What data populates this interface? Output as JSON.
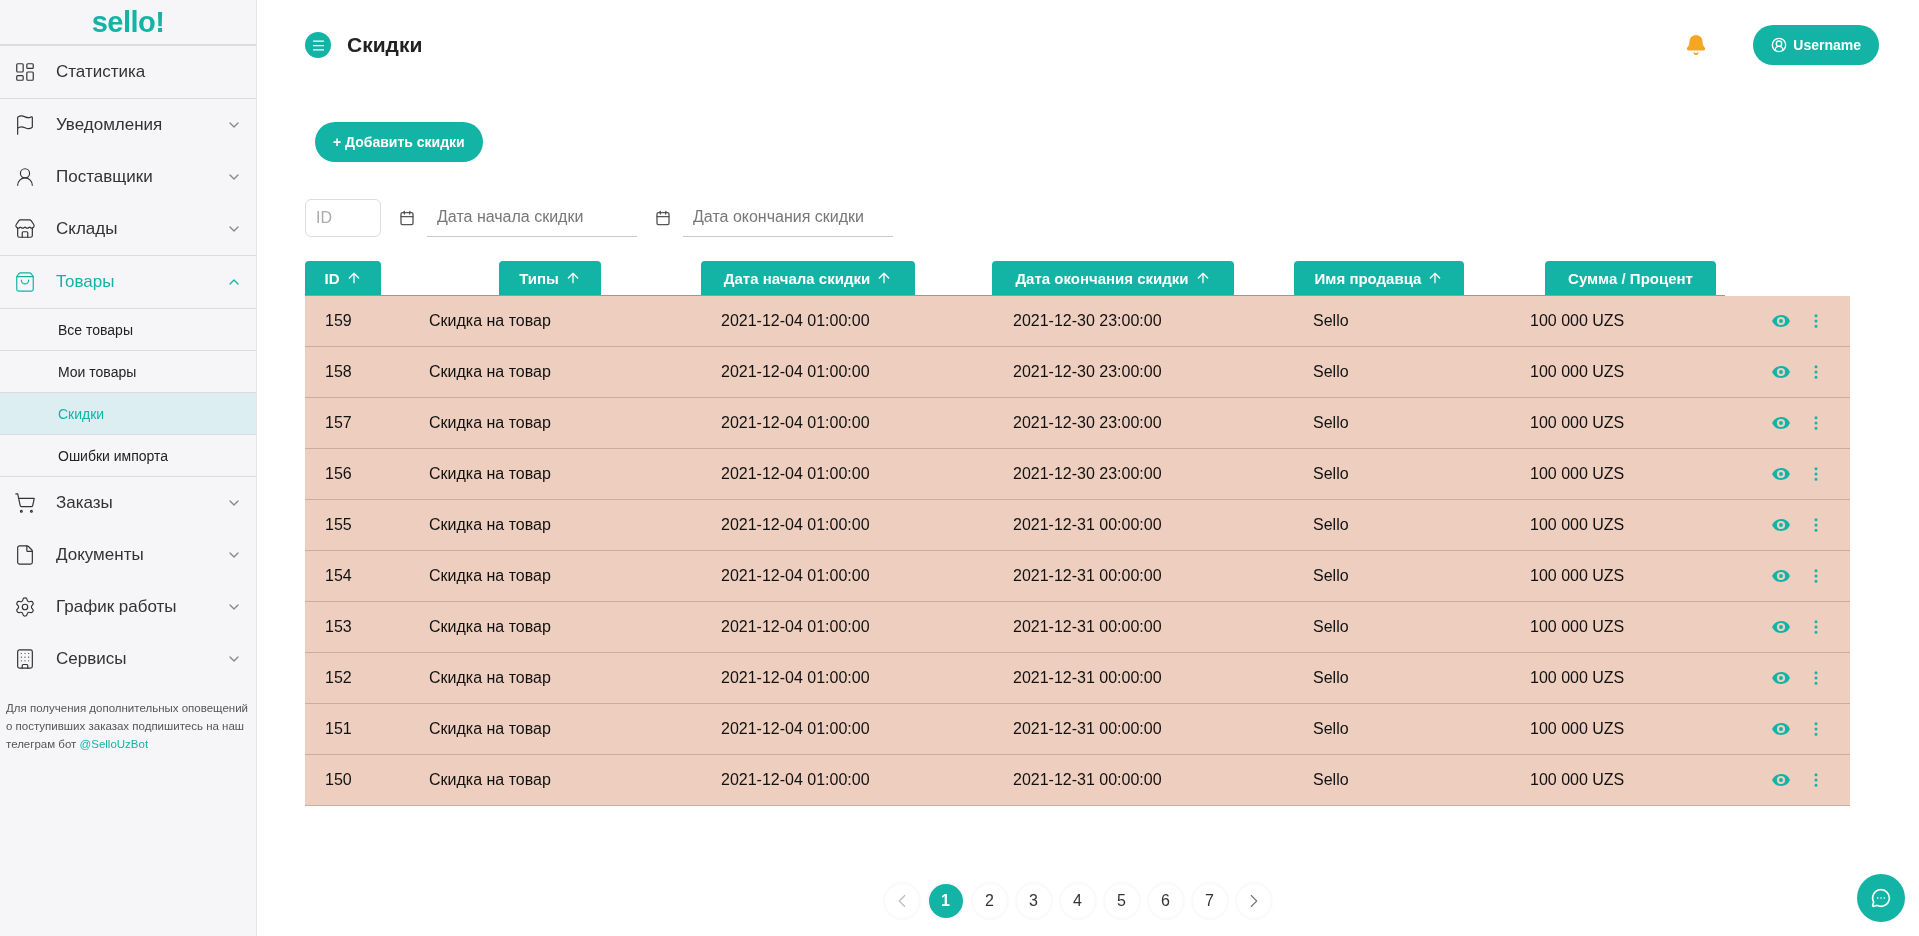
{
  "sidebar": {
    "logo": "sello!",
    "items": [
      {
        "label": "Статистика",
        "expandable": false,
        "expanded": false
      },
      {
        "label": "Уведомления",
        "expandable": true,
        "expanded": false
      },
      {
        "label": "Поставщики",
        "expandable": true,
        "expanded": false
      },
      {
        "label": "Склады",
        "expandable": true,
        "expanded": false
      },
      {
        "label": "Товары",
        "expandable": true,
        "expanded": true,
        "children": [
          {
            "label": "Все товары",
            "selected": false
          },
          {
            "label": "Мои товары",
            "selected": false
          },
          {
            "label": "Скидки",
            "selected": true
          },
          {
            "label": "Ошибки импорта",
            "selected": false
          }
        ]
      },
      {
        "label": "Заказы",
        "expandable": true,
        "expanded": false
      },
      {
        "label": "Документы",
        "expandable": true,
        "expanded": false
      },
      {
        "label": "График работы",
        "expandable": true,
        "expanded": false
      },
      {
        "label": "Сервисы",
        "expandable": true,
        "expanded": false
      }
    ],
    "note": "Для получения дополнительных оповещений о поступивших заказах подпишитесь на наш телеграм бот ",
    "note_link": "@SelloUzBot"
  },
  "header": {
    "title": "Скидки",
    "user": "Username"
  },
  "add_button": "+ Добавить скидки",
  "filters": {
    "id_placeholder": "ID",
    "start_placeholder": "Дата начала скидки",
    "end_placeholder": "Дата окончания скидки"
  },
  "table": {
    "columns": [
      {
        "label": "ID",
        "sortable": true
      },
      {
        "label": "Типы",
        "sortable": true
      },
      {
        "label": "Дата начала скидки",
        "sortable": true
      },
      {
        "label": "Дата окончания скидки",
        "sortable": true
      },
      {
        "label": "Имя продавца",
        "sortable": true
      },
      {
        "label": "Сумма / Процент",
        "sortable": false
      }
    ],
    "rows": [
      [
        "159",
        "Скидка на товар",
        "2021-12-04 01:00:00",
        "2021-12-30 23:00:00",
        "Sello",
        "100 000 UZS"
      ],
      [
        "158",
        "Скидка на товар",
        "2021-12-04 01:00:00",
        "2021-12-30 23:00:00",
        "Sello",
        "100 000 UZS"
      ],
      [
        "157",
        "Скидка на товар",
        "2021-12-04 01:00:00",
        "2021-12-30 23:00:00",
        "Sello",
        "100 000 UZS"
      ],
      [
        "156",
        "Скидка на товар",
        "2021-12-04 01:00:00",
        "2021-12-30 23:00:00",
        "Sello",
        "100 000 UZS"
      ],
      [
        "155",
        "Скидка на товар",
        "2021-12-04 01:00:00",
        "2021-12-31 00:00:00",
        "Sello",
        "100 000 UZS"
      ],
      [
        "154",
        "Скидка на товар",
        "2021-12-04 01:00:00",
        "2021-12-31 00:00:00",
        "Sello",
        "100 000 UZS"
      ],
      [
        "153",
        "Скидка на товар",
        "2021-12-04 01:00:00",
        "2021-12-31 00:00:00",
        "Sello",
        "100 000 UZS"
      ],
      [
        "152",
        "Скидка на товар",
        "2021-12-04 01:00:00",
        "2021-12-31 00:00:00",
        "Sello",
        "100 000 UZS"
      ],
      [
        "151",
        "Скидка на товар",
        "2021-12-04 01:00:00",
        "2021-12-31 00:00:00",
        "Sello",
        "100 000 UZS"
      ],
      [
        "150",
        "Скидка на товар",
        "2021-12-04 01:00:00",
        "2021-12-31 00:00:00",
        "Sello",
        "100 000 UZS"
      ]
    ]
  },
  "pagination": [
    {
      "label": "1",
      "selected": true
    },
    {
      "label": "2",
      "selected": false
    },
    {
      "label": "3",
      "selected": false
    },
    {
      "label": "4",
      "selected": false
    },
    {
      "label": "5",
      "selected": false
    },
    {
      "label": "6",
      "selected": false
    },
    {
      "label": "7",
      "selected": false
    }
  ]
}
